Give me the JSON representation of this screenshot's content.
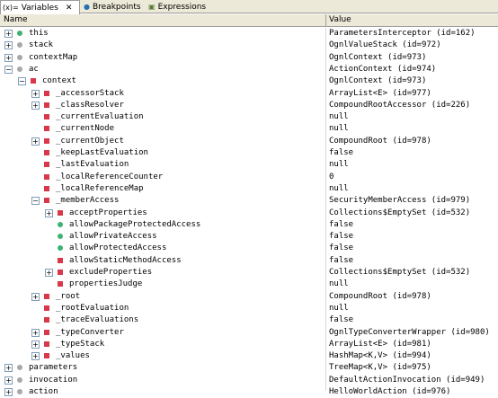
{
  "tabs": [
    {
      "icon": "(x)=",
      "label": "Variables",
      "close": "✕"
    },
    {
      "icon": "●",
      "label": "Breakpoints"
    },
    {
      "icon": "▣",
      "label": "Expressions"
    }
  ],
  "columns": {
    "name": "Name",
    "value": "Value"
  },
  "rows": [
    {
      "depth": 0,
      "exp": "+",
      "icon": "green",
      "name": "this",
      "value": "ParametersInterceptor  (id=162)"
    },
    {
      "depth": 0,
      "exp": "+",
      "icon": "grey",
      "name": "stack",
      "value": "OgnlValueStack  (id=972)"
    },
    {
      "depth": 0,
      "exp": "+",
      "icon": "grey",
      "name": "contextMap",
      "value": "OgnlContext  (id=973)"
    },
    {
      "depth": 0,
      "exp": "-",
      "icon": "grey",
      "name": "ac",
      "value": "ActionContext  (id=974)"
    },
    {
      "depth": 1,
      "exp": "-",
      "icon": "red",
      "name": "context",
      "value": "OgnlContext  (id=973)"
    },
    {
      "depth": 2,
      "exp": "+",
      "icon": "red",
      "name": "_accessorStack",
      "value": "ArrayList<E>  (id=977)"
    },
    {
      "depth": 2,
      "exp": "+",
      "icon": "red",
      "name": "_classResolver",
      "value": "CompoundRootAccessor  (id=226)"
    },
    {
      "depth": 2,
      "exp": "",
      "icon": "red",
      "name": "_currentEvaluation",
      "value": "null"
    },
    {
      "depth": 2,
      "exp": "",
      "icon": "red",
      "name": "_currentNode",
      "value": "null"
    },
    {
      "depth": 2,
      "exp": "+",
      "icon": "red",
      "name": "_currentObject",
      "value": "CompoundRoot  (id=978)"
    },
    {
      "depth": 2,
      "exp": "",
      "icon": "red",
      "name": "_keepLastEvaluation",
      "value": "false"
    },
    {
      "depth": 2,
      "exp": "",
      "icon": "red",
      "name": "_lastEvaluation",
      "value": "null"
    },
    {
      "depth": 2,
      "exp": "",
      "icon": "red",
      "name": "_localReferenceCounter",
      "value": "0"
    },
    {
      "depth": 2,
      "exp": "",
      "icon": "red",
      "name": "_localReferenceMap",
      "value": "null"
    },
    {
      "depth": 2,
      "exp": "-",
      "icon": "red",
      "name": "_memberAccess",
      "value": "SecurityMemberAccess  (id=979)"
    },
    {
      "depth": 3,
      "exp": "+",
      "icon": "red",
      "name": "acceptProperties",
      "value": "Collections$EmptySet  (id=532)"
    },
    {
      "depth": 3,
      "exp": "",
      "icon": "green",
      "name": "allowPackageProtectedAccess",
      "value": "false"
    },
    {
      "depth": 3,
      "exp": "",
      "icon": "green",
      "name": "allowPrivateAccess",
      "value": "false"
    },
    {
      "depth": 3,
      "exp": "",
      "icon": "green",
      "name": "allowProtectedAccess",
      "value": "false"
    },
    {
      "depth": 3,
      "exp": "",
      "icon": "red",
      "name": "allowStaticMethodAccess",
      "value": "false"
    },
    {
      "depth": 3,
      "exp": "+",
      "icon": "red",
      "name": "excludeProperties",
      "value": "Collections$EmptySet  (id=532)"
    },
    {
      "depth": 3,
      "exp": "",
      "icon": "red",
      "name": "propertiesJudge",
      "value": "null"
    },
    {
      "depth": 2,
      "exp": "+",
      "icon": "red",
      "name": "_root",
      "value": "CompoundRoot  (id=978)"
    },
    {
      "depth": 2,
      "exp": "",
      "icon": "red",
      "name": "_rootEvaluation",
      "value": "null"
    },
    {
      "depth": 2,
      "exp": "",
      "icon": "red",
      "name": "_traceEvaluations",
      "value": "false"
    },
    {
      "depth": 2,
      "exp": "+",
      "icon": "red",
      "name": "_typeConverter",
      "value": "OgnlTypeConverterWrapper  (id=980)"
    },
    {
      "depth": 2,
      "exp": "+",
      "icon": "red",
      "name": "_typeStack",
      "value": "ArrayList<E>  (id=981)"
    },
    {
      "depth": 2,
      "exp": "+",
      "icon": "red",
      "name": "_values",
      "value": "HashMap<K,V>  (id=994)"
    },
    {
      "depth": 0,
      "exp": "+",
      "icon": "grey",
      "name": "parameters",
      "value": "TreeMap<K,V>  (id=975)"
    },
    {
      "depth": 0,
      "exp": "+",
      "icon": "grey",
      "name": "invocation",
      "value": "DefaultActionInvocation  (id=949)"
    },
    {
      "depth": 0,
      "exp": "+",
      "icon": "grey",
      "name": "action",
      "value": "HelloWorldAction  (id=976)"
    }
  ],
  "colors": {
    "red": "#d8384a",
    "green": "#3cb371",
    "grey": "#a8a8a8",
    "header_bg": "#ece9d8"
  }
}
